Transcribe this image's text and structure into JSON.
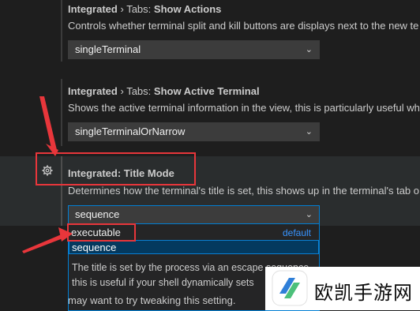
{
  "settings": [
    {
      "category": "Integrated",
      "subcategory": "Tabs:",
      "name": "Show Actions",
      "description": "Controls whether terminal split and kill buttons are displays next to the new te",
      "value": "singleTerminal"
    },
    {
      "category": "Integrated",
      "subcategory": "Tabs:",
      "name": "Show Active Terminal",
      "description": "Shows the active terminal information in the view, this is particularly useful wh",
      "value": "singleTerminalOrNarrow"
    },
    {
      "category": "Integrated:",
      "name": "Title Mode",
      "description": "Determines how the terminal's title is set, this shows up in the terminal's tab o",
      "value": "sequence",
      "options": [
        {
          "label": "executable",
          "badge": "default"
        },
        {
          "label": "sequence"
        }
      ],
      "option_description_lines": [
        "The title is set by the process via an escape sequence",
        "this is useful if your shell dynamically sets"
      ],
      "trailing_text": "may want to try tweaking this setting."
    }
  ],
  "separator": "›",
  "chevron": "⌄",
  "watermark": {
    "text": "欧凯手游网"
  },
  "colors": {
    "accent": "#007fd4",
    "annotation": "#e8363b"
  }
}
